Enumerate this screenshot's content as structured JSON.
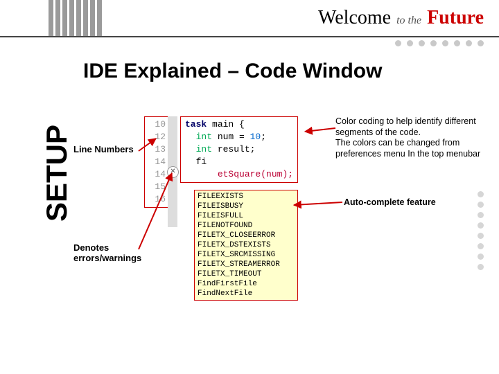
{
  "header": {
    "logo_welcome": "Welcome",
    "logo_to_the": "to the",
    "logo_future": "Future"
  },
  "title": "IDE Explained – Code Window",
  "sidebar_text": "SETUP",
  "labels": {
    "line_numbers": "Line Numbers",
    "errors": "Denotes\nerrors/warnings",
    "color_coding": "Color coding to help identify different segments of the code.\nThe colors can be changed from preferences menu In the top menubar",
    "autocomplete": "Auto-complete feature"
  },
  "code": {
    "line_numbers": [
      "10",
      "12",
      "13",
      "14",
      "14",
      "15",
      "16"
    ],
    "text_kw_task": "task",
    "text_main": " main {",
    "text_typ_int1": "int",
    "text_num_decl": " num = ",
    "text_lit_10": "10",
    "text_semicolon": ";",
    "text_typ_int2": "int",
    "text_result": " result;",
    "text_fi": "fi",
    "text_blank": "    ",
    "text_call_setsq": "etSquare(num);",
    "autocomplete_items": [
      "FILEEXISTS",
      "FILEISBUSY",
      "FILEISFULL",
      "FILENOTFOUND",
      "FILETX_CLOSEERROR",
      "FILETX_DSTEXISTS",
      "FILETX_SRCMISSING",
      "FILETX_STREAMERROR",
      "FILETX_TIMEOUT",
      "FindFirstFile",
      "FindNextFile"
    ],
    "error_badge": "✕"
  }
}
